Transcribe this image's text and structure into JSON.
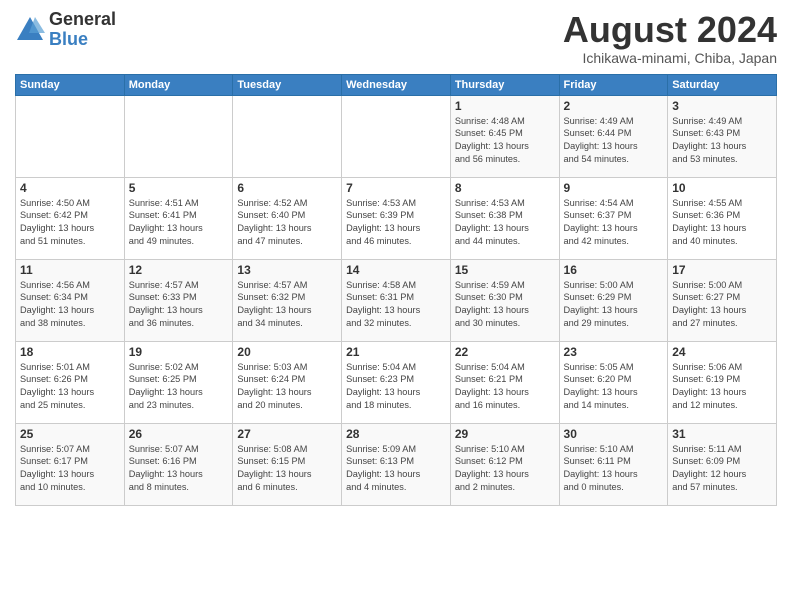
{
  "header": {
    "logo_general": "General",
    "logo_blue": "Blue",
    "month": "August 2024",
    "location": "Ichikawa-minami, Chiba, Japan"
  },
  "weekdays": [
    "Sunday",
    "Monday",
    "Tuesday",
    "Wednesday",
    "Thursday",
    "Friday",
    "Saturday"
  ],
  "weeks": [
    [
      {
        "day": "",
        "content": ""
      },
      {
        "day": "",
        "content": ""
      },
      {
        "day": "",
        "content": ""
      },
      {
        "day": "",
        "content": ""
      },
      {
        "day": "1",
        "content": "Sunrise: 4:48 AM\nSunset: 6:45 PM\nDaylight: 13 hours\nand 56 minutes."
      },
      {
        "day": "2",
        "content": "Sunrise: 4:49 AM\nSunset: 6:44 PM\nDaylight: 13 hours\nand 54 minutes."
      },
      {
        "day": "3",
        "content": "Sunrise: 4:49 AM\nSunset: 6:43 PM\nDaylight: 13 hours\nand 53 minutes."
      }
    ],
    [
      {
        "day": "4",
        "content": "Sunrise: 4:50 AM\nSunset: 6:42 PM\nDaylight: 13 hours\nand 51 minutes."
      },
      {
        "day": "5",
        "content": "Sunrise: 4:51 AM\nSunset: 6:41 PM\nDaylight: 13 hours\nand 49 minutes."
      },
      {
        "day": "6",
        "content": "Sunrise: 4:52 AM\nSunset: 6:40 PM\nDaylight: 13 hours\nand 47 minutes."
      },
      {
        "day": "7",
        "content": "Sunrise: 4:53 AM\nSunset: 6:39 PM\nDaylight: 13 hours\nand 46 minutes."
      },
      {
        "day": "8",
        "content": "Sunrise: 4:53 AM\nSunset: 6:38 PM\nDaylight: 13 hours\nand 44 minutes."
      },
      {
        "day": "9",
        "content": "Sunrise: 4:54 AM\nSunset: 6:37 PM\nDaylight: 13 hours\nand 42 minutes."
      },
      {
        "day": "10",
        "content": "Sunrise: 4:55 AM\nSunset: 6:36 PM\nDaylight: 13 hours\nand 40 minutes."
      }
    ],
    [
      {
        "day": "11",
        "content": "Sunrise: 4:56 AM\nSunset: 6:34 PM\nDaylight: 13 hours\nand 38 minutes."
      },
      {
        "day": "12",
        "content": "Sunrise: 4:57 AM\nSunset: 6:33 PM\nDaylight: 13 hours\nand 36 minutes."
      },
      {
        "day": "13",
        "content": "Sunrise: 4:57 AM\nSunset: 6:32 PM\nDaylight: 13 hours\nand 34 minutes."
      },
      {
        "day": "14",
        "content": "Sunrise: 4:58 AM\nSunset: 6:31 PM\nDaylight: 13 hours\nand 32 minutes."
      },
      {
        "day": "15",
        "content": "Sunrise: 4:59 AM\nSunset: 6:30 PM\nDaylight: 13 hours\nand 30 minutes."
      },
      {
        "day": "16",
        "content": "Sunrise: 5:00 AM\nSunset: 6:29 PM\nDaylight: 13 hours\nand 29 minutes."
      },
      {
        "day": "17",
        "content": "Sunrise: 5:00 AM\nSunset: 6:27 PM\nDaylight: 13 hours\nand 27 minutes."
      }
    ],
    [
      {
        "day": "18",
        "content": "Sunrise: 5:01 AM\nSunset: 6:26 PM\nDaylight: 13 hours\nand 25 minutes."
      },
      {
        "day": "19",
        "content": "Sunrise: 5:02 AM\nSunset: 6:25 PM\nDaylight: 13 hours\nand 23 minutes."
      },
      {
        "day": "20",
        "content": "Sunrise: 5:03 AM\nSunset: 6:24 PM\nDaylight: 13 hours\nand 20 minutes."
      },
      {
        "day": "21",
        "content": "Sunrise: 5:04 AM\nSunset: 6:23 PM\nDaylight: 13 hours\nand 18 minutes."
      },
      {
        "day": "22",
        "content": "Sunrise: 5:04 AM\nSunset: 6:21 PM\nDaylight: 13 hours\nand 16 minutes."
      },
      {
        "day": "23",
        "content": "Sunrise: 5:05 AM\nSunset: 6:20 PM\nDaylight: 13 hours\nand 14 minutes."
      },
      {
        "day": "24",
        "content": "Sunrise: 5:06 AM\nSunset: 6:19 PM\nDaylight: 13 hours\nand 12 minutes."
      }
    ],
    [
      {
        "day": "25",
        "content": "Sunrise: 5:07 AM\nSunset: 6:17 PM\nDaylight: 13 hours\nand 10 minutes."
      },
      {
        "day": "26",
        "content": "Sunrise: 5:07 AM\nSunset: 6:16 PM\nDaylight: 13 hours\nand 8 minutes."
      },
      {
        "day": "27",
        "content": "Sunrise: 5:08 AM\nSunset: 6:15 PM\nDaylight: 13 hours\nand 6 minutes."
      },
      {
        "day": "28",
        "content": "Sunrise: 5:09 AM\nSunset: 6:13 PM\nDaylight: 13 hours\nand 4 minutes."
      },
      {
        "day": "29",
        "content": "Sunrise: 5:10 AM\nSunset: 6:12 PM\nDaylight: 13 hours\nand 2 minutes."
      },
      {
        "day": "30",
        "content": "Sunrise: 5:10 AM\nSunset: 6:11 PM\nDaylight: 13 hours\nand 0 minutes."
      },
      {
        "day": "31",
        "content": "Sunrise: 5:11 AM\nSunset: 6:09 PM\nDaylight: 12 hours\nand 57 minutes."
      }
    ]
  ]
}
